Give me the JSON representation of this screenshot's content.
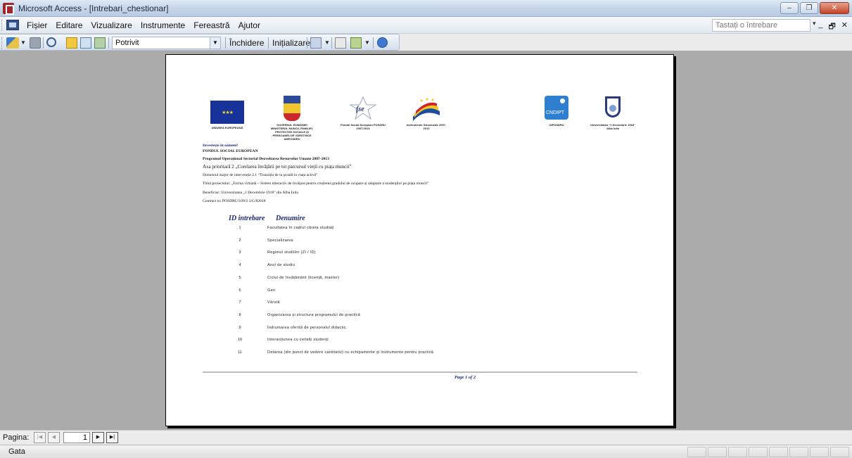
{
  "window": {
    "title": "Microsoft Access - [Intrebari_chestionar]",
    "buttons": {
      "minimize": "–",
      "restore": "❐",
      "close": "✕"
    }
  },
  "menu": {
    "items": [
      "Fișier",
      "Editare",
      "Vizualizare",
      "Instrumente",
      "Fereastră",
      "Ajutor"
    ],
    "ask_placeholder": "Tastați o întrebare",
    "mdi_buttons": [
      "▾",
      "_",
      "🗗",
      "✕"
    ]
  },
  "toolbar": {
    "zoom_value": "Potrivit",
    "close_label": "Închidere",
    "setup_label": "Inițializare"
  },
  "report": {
    "logos": {
      "eu_caption": "UNIUNEA EUROPEANĂ",
      "gov_caption": "GUVERNUL ROMÂNIEI MINISTERUL MUNCII, FAMILIEI, PROTECȚIEI SOCIALE ȘI PERSOANELOR VÂRSTNICE AMPOSDRU",
      "fse_caption": "Fondul Social European POSDRU 2007-2013",
      "struct_caption": "Instrumente Structurale 2007-2013",
      "cndipt_caption": "OIPOSDRU",
      "cndipt_label": "CNDIPT",
      "univ_caption": "Universitatea \"1 Decembrie 1918\" Alba Iulia"
    },
    "header_lines": [
      "Investește în oameni!",
      "FONDUL SOCIAL EUROPEAN",
      "Programul Operațional Sectorial Dezvoltarea Resurselor Umane 2007-2013",
      "Axa prioritară 2 „Corelarea învățării pe tot parcursul vieții cu piața muncii”",
      "Domeniul major de intervenție 2.1 “Tranziția de la școală la viața activă”",
      "Titlul proiectului: „Forma virtuală – Sistem interactiv de învățare pentru creșterea gradului de ocupare și adaptare a studenților pe piața muncii”",
      "Beneficiar: Universitatea „1 Decembrie 1918” din Alba Iulia",
      "Contract nr. POSDRU/109/2.1/G/82018"
    ],
    "columns": {
      "id": "ID intrebare",
      "name": "Denumire"
    },
    "rows": [
      {
        "id": "1",
        "name": "Facultatea în cadrul căreia studiați"
      },
      {
        "id": "2",
        "name": "Specializarea"
      },
      {
        "id": "3",
        "name": "Regimul studiilor (ZI / ID)"
      },
      {
        "id": "4",
        "name": "Anul de studiu"
      },
      {
        "id": "5",
        "name": "Ciclul de învățământ (licență, master)"
      },
      {
        "id": "6",
        "name": "Gen"
      },
      {
        "id": "7",
        "name": "Vârstă"
      },
      {
        "id": "8",
        "name": "Organizarea și structura programului de practică"
      },
      {
        "id": "9",
        "name": "Îndrumarea oferită de personalul didactic"
      },
      {
        "id": "10",
        "name": "Interacțiunea cu ceilalți studenți"
      },
      {
        "id": "11",
        "name": "Dotarea (din punct de vedere cantitativ) cu echipamente și instrumente pentru practică"
      }
    ],
    "page_label": "Page 1 of 2"
  },
  "navigation": {
    "label": "Pagina:",
    "current_page": "1",
    "buttons": {
      "first": "|◀",
      "prev": "◀",
      "next": "▶",
      "last": "▶|"
    }
  },
  "status": {
    "text": "Gata"
  },
  "colors": {
    "accent_navy": "#1e2a78",
    "preview_bg": "#aaaaaa",
    "eu_blue": "#17339a"
  }
}
